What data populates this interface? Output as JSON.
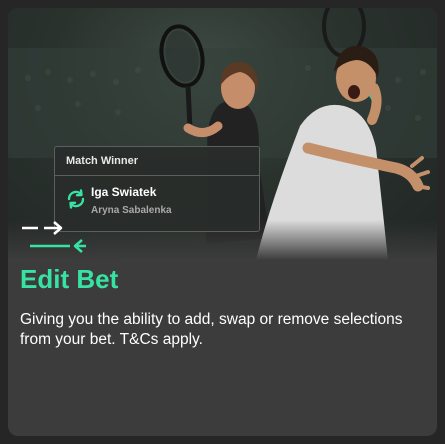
{
  "promo": {
    "title": "Edit Bet",
    "description": "Giving you the ability to add, swap or remove selections from your bet. T&Cs apply."
  },
  "bet_slip": {
    "market": "Match Winner",
    "selection": "Iga Swiatek",
    "opponent": "Aryna Sabalenka"
  },
  "icons": {
    "swap": "swap-arrows-icon",
    "edit_arrows": "edit-arrows-icon"
  },
  "colors": {
    "accent": "#37e3a3",
    "card_background": "#3c3c3c",
    "page_background": "#262626"
  }
}
